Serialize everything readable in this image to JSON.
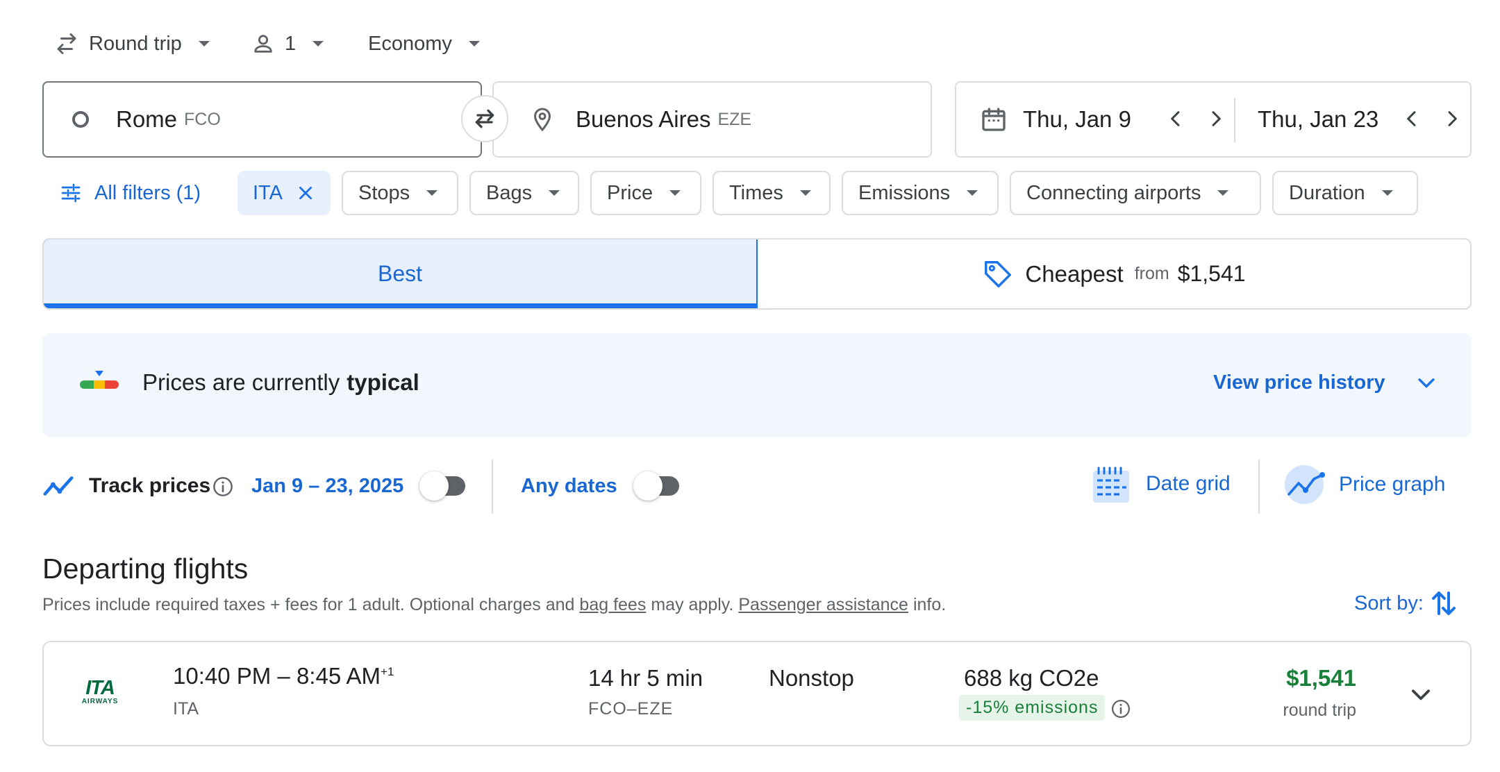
{
  "top": {
    "trip_type": "Round trip",
    "passengers": "1",
    "cabin": "Economy"
  },
  "search": {
    "origin_city": "Rome",
    "origin_code": "FCO",
    "destination_city": "Buenos Aires",
    "destination_code": "EZE",
    "depart_date": "Thu, Jan 9",
    "return_date": "Thu, Jan 23"
  },
  "filters": {
    "all_filters": "All filters (1)",
    "airline_chip": "ITA",
    "chips": [
      "Stops",
      "Bags",
      "Price",
      "Times",
      "Emissions",
      "Connecting airports",
      "Duration"
    ]
  },
  "tabs": {
    "best": "Best",
    "cheapest": "Cheapest",
    "from": "from",
    "cheapest_price": "$1,541"
  },
  "insight": {
    "text_prefix": "Prices are currently",
    "text_level": "typical",
    "view_history": "View price history"
  },
  "track": {
    "label": "Track prices",
    "dates": "Jan 9 – 23, 2025",
    "any_dates": "Any dates",
    "date_grid": "Date grid",
    "price_graph": "Price graph"
  },
  "results": {
    "title": "Departing flights",
    "note_part1": "Prices include required taxes + fees for 1 adult. Optional charges and",
    "bag_fees": "bag fees",
    "note_part2": "may apply.",
    "passenger_assistance": "Passenger assistance",
    "note_part3": "info.",
    "sort_by": "Sort by:"
  },
  "flight": {
    "logo_text": "ITA",
    "logo_sub": "AIRWAYS",
    "times": "10:40 PM – 8:45 AM",
    "day_offset": "+1",
    "airline": "ITA",
    "duration": "14 hr 5 min",
    "route": "FCO–EZE",
    "stops": "Nonstop",
    "emissions": "688 kg CO2e",
    "emissions_badge": "-15% emissions",
    "price": "$1,541",
    "price_type": "round trip"
  },
  "colors": {
    "accent": "#1a73e8",
    "link": "#1967d2",
    "price_green": "#188038",
    "badge_bg": "#e6f4ea"
  }
}
